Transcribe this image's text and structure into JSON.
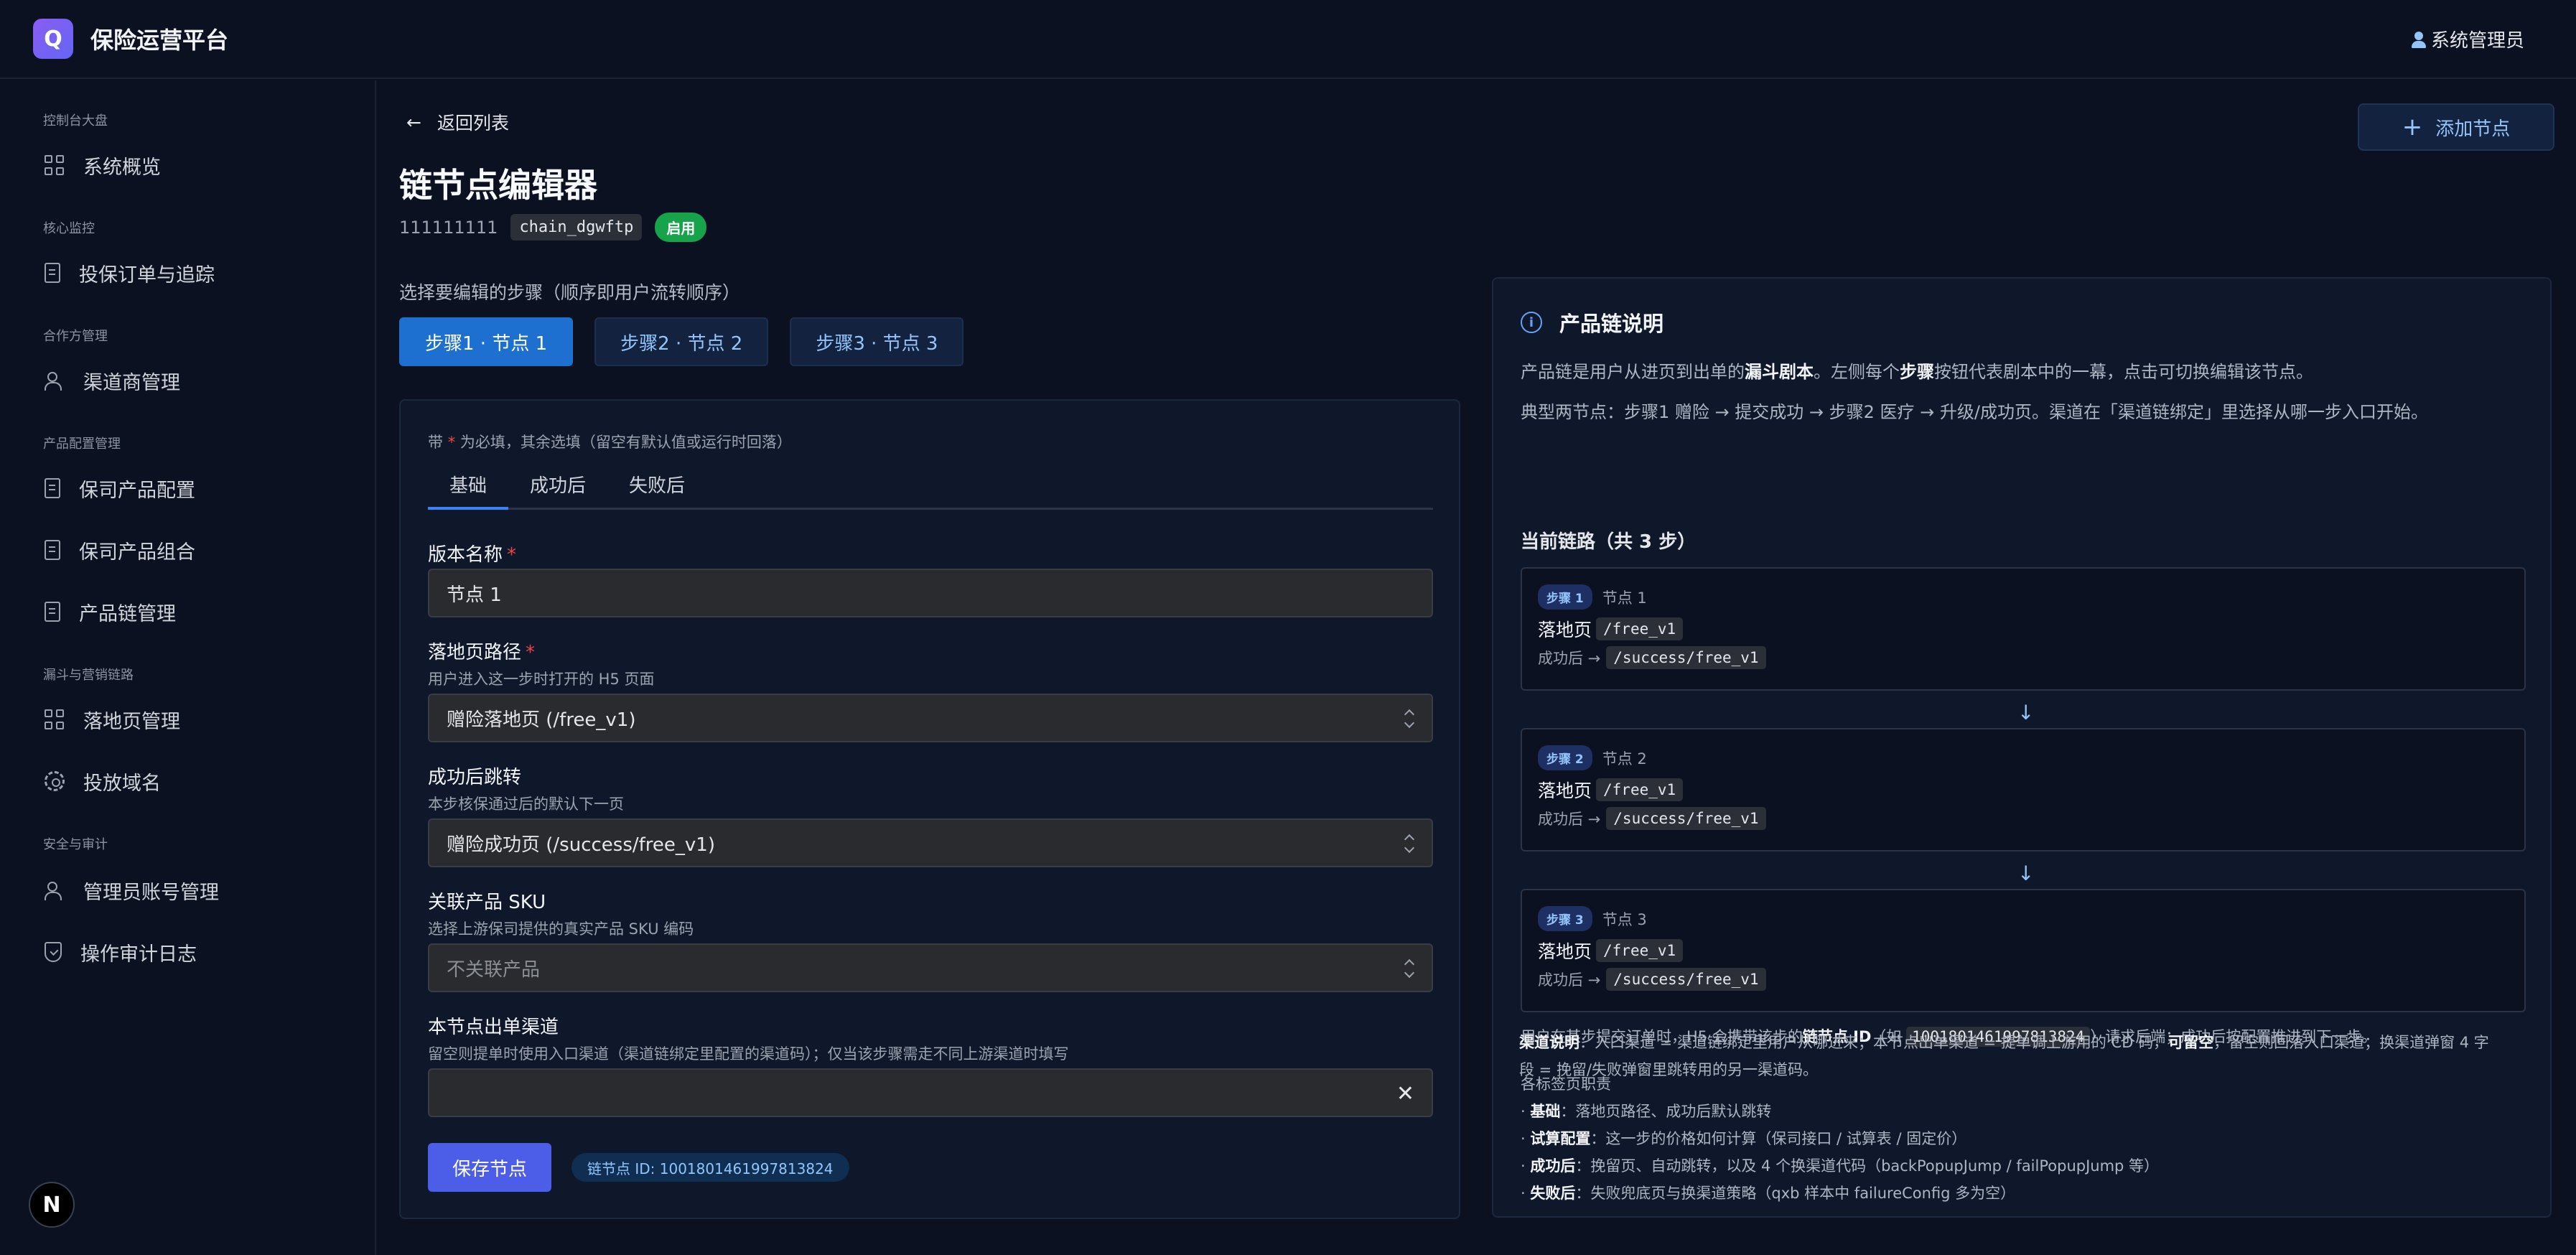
{
  "app": {
    "logo_letter": "Q",
    "title": "保险运营平台",
    "user": "系统管理员"
  },
  "sidebar": {
    "groups": [
      {
        "label": "控制台大盘",
        "items": [
          {
            "label": "系统概览",
            "icon": "dashboard-icon"
          }
        ]
      },
      {
        "label": "核心监控",
        "items": [
          {
            "label": "投保订单与追踪",
            "icon": "order-icon"
          }
        ]
      },
      {
        "label": "合作方管理",
        "items": [
          {
            "label": "渠道商管理",
            "icon": "users-icon"
          }
        ]
      },
      {
        "label": "产品配置管理",
        "items": [
          {
            "label": "保司产品配置",
            "icon": "building-icon"
          },
          {
            "label": "保司产品组合",
            "icon": "document-icon"
          },
          {
            "label": "产品链管理",
            "icon": "document-icon"
          }
        ]
      },
      {
        "label": "漏斗与营销链路",
        "items": [
          {
            "label": "落地页管理",
            "icon": "layout-icon"
          },
          {
            "label": "投放域名",
            "icon": "gear-icon"
          }
        ]
      },
      {
        "label": "安全与审计",
        "items": [
          {
            "label": "管理员账号管理",
            "icon": "user-key-icon"
          },
          {
            "label": "操作审计日志",
            "icon": "shield-icon"
          }
        ]
      }
    ],
    "badge": "N"
  },
  "header": {
    "back": "返回列表",
    "add_node": "添加节点",
    "title": "链节点编辑器",
    "chain_num": "111111111",
    "chain_code": "chain_dgwftp",
    "status": "启用"
  },
  "steps": {
    "label": "选择要编辑的步骤（顺序即用户流转顺序）",
    "tabs": [
      "步骤1 · 节点 1",
      "步骤2 · 节点 2",
      "步骤3 · 节点 3"
    ]
  },
  "form": {
    "note_pre": "带 ",
    "note_star": "*",
    "note_post": " 为必填，其余选填（留空有默认值或运行时回落）",
    "tabs": [
      "基础",
      "成功后",
      "失败后"
    ],
    "version_label": "版本名称",
    "version_value": "节点 1",
    "landing_label": "落地页路径",
    "landing_help": "用户进入这一步时打开的 H5 页面",
    "landing_value": "赠险落地页 (/free_v1)",
    "success_label": "成功后跳转",
    "success_help": "本步核保通过后的默认下一页",
    "success_value": "赠险成功页 (/success/free_v1)",
    "sku_label": "关联产品 SKU",
    "sku_help": "选择上游保司提供的真实产品 SKU 编码",
    "sku_placeholder": "不关联产品",
    "channel_label": "本节点出单渠道",
    "channel_help": "留空则提单时使用入口渠道（渠道链绑定里配置的渠道码）；仅当该步骤需走不同上游渠道时填写",
    "channel_value": "",
    "save": "保存节点",
    "id_chip": "链节点 ID: 1001801461997813824"
  },
  "info": {
    "title": "产品链说明",
    "p1_a": "产品链是用户从进页到出单的",
    "p1_b": "漏斗剧本",
    "p1_c": "。左侧每个",
    "p1_d": "步骤",
    "p1_e": "按钮代表剧本中的一幕，点击可切换编辑该节点。",
    "p2": "典型两节点：步骤1 赠险 → 提交成功 → 步骤2 医疗 → 升级/成功页。渠道在「渠道链绑定」里选择从哪一步入口开始。",
    "chain_title": "当前链路（共 3 步）",
    "chain": [
      {
        "badge": "步骤 1",
        "node": "节点 1",
        "landing_label": "落地页",
        "landing": "/free_v1",
        "after_label": "成功后 →",
        "after": "/success/free_v1"
      },
      {
        "badge": "步骤 2",
        "node": "节点 2",
        "landing_label": "落地页",
        "landing": "/free_v1",
        "after_label": "成功后 →",
        "after": "/success/free_v1"
      },
      {
        "badge": "步骤 3",
        "node": "节点 3",
        "landing_label": "落地页",
        "landing": "/free_v1",
        "after_label": "成功后 →",
        "after": "/success/free_v1"
      }
    ],
    "arrow": "↓",
    "id_line_a": "用户在某步提交订单时，H5 会携带该步的",
    "id_line_b": "链节点 ID",
    "id_line_c": "（如 ",
    "id_line_id": "1001801461997813824",
    "id_line_d": "）请求后端；成功后按配置推进到下一步。",
    "duties_title": "各标签页职责",
    "duties": [
      {
        "k": "基础",
        "v": "：落地页路径、成功后默认跳转"
      },
      {
        "k": "试算配置",
        "v": "：这一步的价格如何计算（保司接口 / 试算表 / 固定价）"
      },
      {
        "k": "成功后",
        "v": "：挽留页、自动跳转，以及 4 个换渠道代码（backPopupJump / failPopupJump 等）"
      },
      {
        "k": "失败后",
        "v": "：失败兜底页与换渠道策略（qxb 样本中 failureConfig 多为空）"
      }
    ],
    "channel_note_k": "渠道说明",
    "channel_note_a": "：入口渠道 = 渠道链绑定里用户从哪进来；本节点出单渠道 = 提单调上游用的 CD 码，",
    "channel_note_b": "可留空",
    "channel_note_c": "，留空则回落入口渠道；换渠道弹窗 4 字",
    "channel_note_d": "段 = 挽留/失败弹窗里跳转用的另一渠道码。"
  }
}
